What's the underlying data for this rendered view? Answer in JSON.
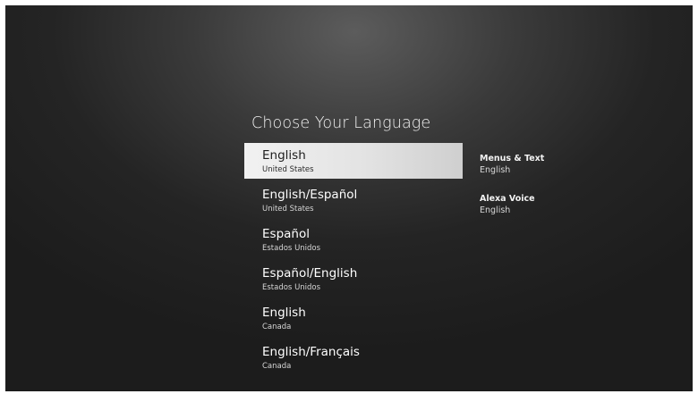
{
  "screen": {
    "title": "Choose Your Language"
  },
  "languages": [
    {
      "name": "English",
      "region": "United States",
      "selected": true
    },
    {
      "name": "English/Español",
      "region": "United States",
      "selected": false
    },
    {
      "name": "Español",
      "region": "Estados Unidos",
      "selected": false
    },
    {
      "name": "Español/English",
      "region": "Estados Unidos",
      "selected": false
    },
    {
      "name": "English",
      "region": "Canada",
      "selected": false
    },
    {
      "name": "English/Français",
      "region": "Canada",
      "selected": false
    }
  ],
  "details": {
    "menus": {
      "label": "Menus & Text",
      "value": "English"
    },
    "voice": {
      "label": "Alexa Voice",
      "value": "English"
    }
  },
  "colors": {
    "background": "#1c1c1c",
    "highlight": "#e8e8e8",
    "text": "#ffffff",
    "selected_text": "#1e1e1e"
  }
}
